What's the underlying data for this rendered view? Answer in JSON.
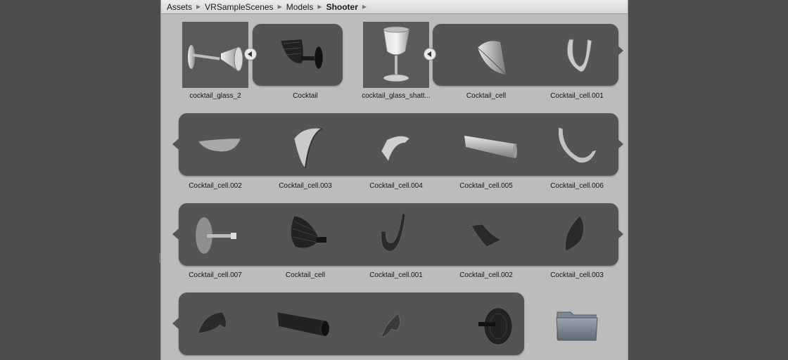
{
  "breadcrumb": [
    "Assets",
    "VRSampleScenes",
    "Models",
    "Shooter"
  ],
  "assets": [
    "cocktail_glass_2",
    "Cocktail",
    "cocktail_glass_shatt...",
    "Cocktail_cell",
    "Cocktail_cell.001",
    "Cocktail_cell.002",
    "Cocktail_cell.003",
    "Cocktail_cell.004",
    "Cocktail_cell.005",
    "Cocktail_cell.006",
    "Cocktail_cell.007",
    "Cocktail_cell",
    "Cocktail_cell.001",
    "Cocktail_cell.002",
    "Cocktail_cell.003"
  ],
  "icons": {
    "expand": "expand-arrow-icon",
    "folder": "folder-icon",
    "mesh": "mesh-preview-icon"
  },
  "colors": {
    "panel": "#bcbcbc",
    "background": "#4d4d4d",
    "pill": "#545454",
    "thumb": "#5a5a5a"
  }
}
